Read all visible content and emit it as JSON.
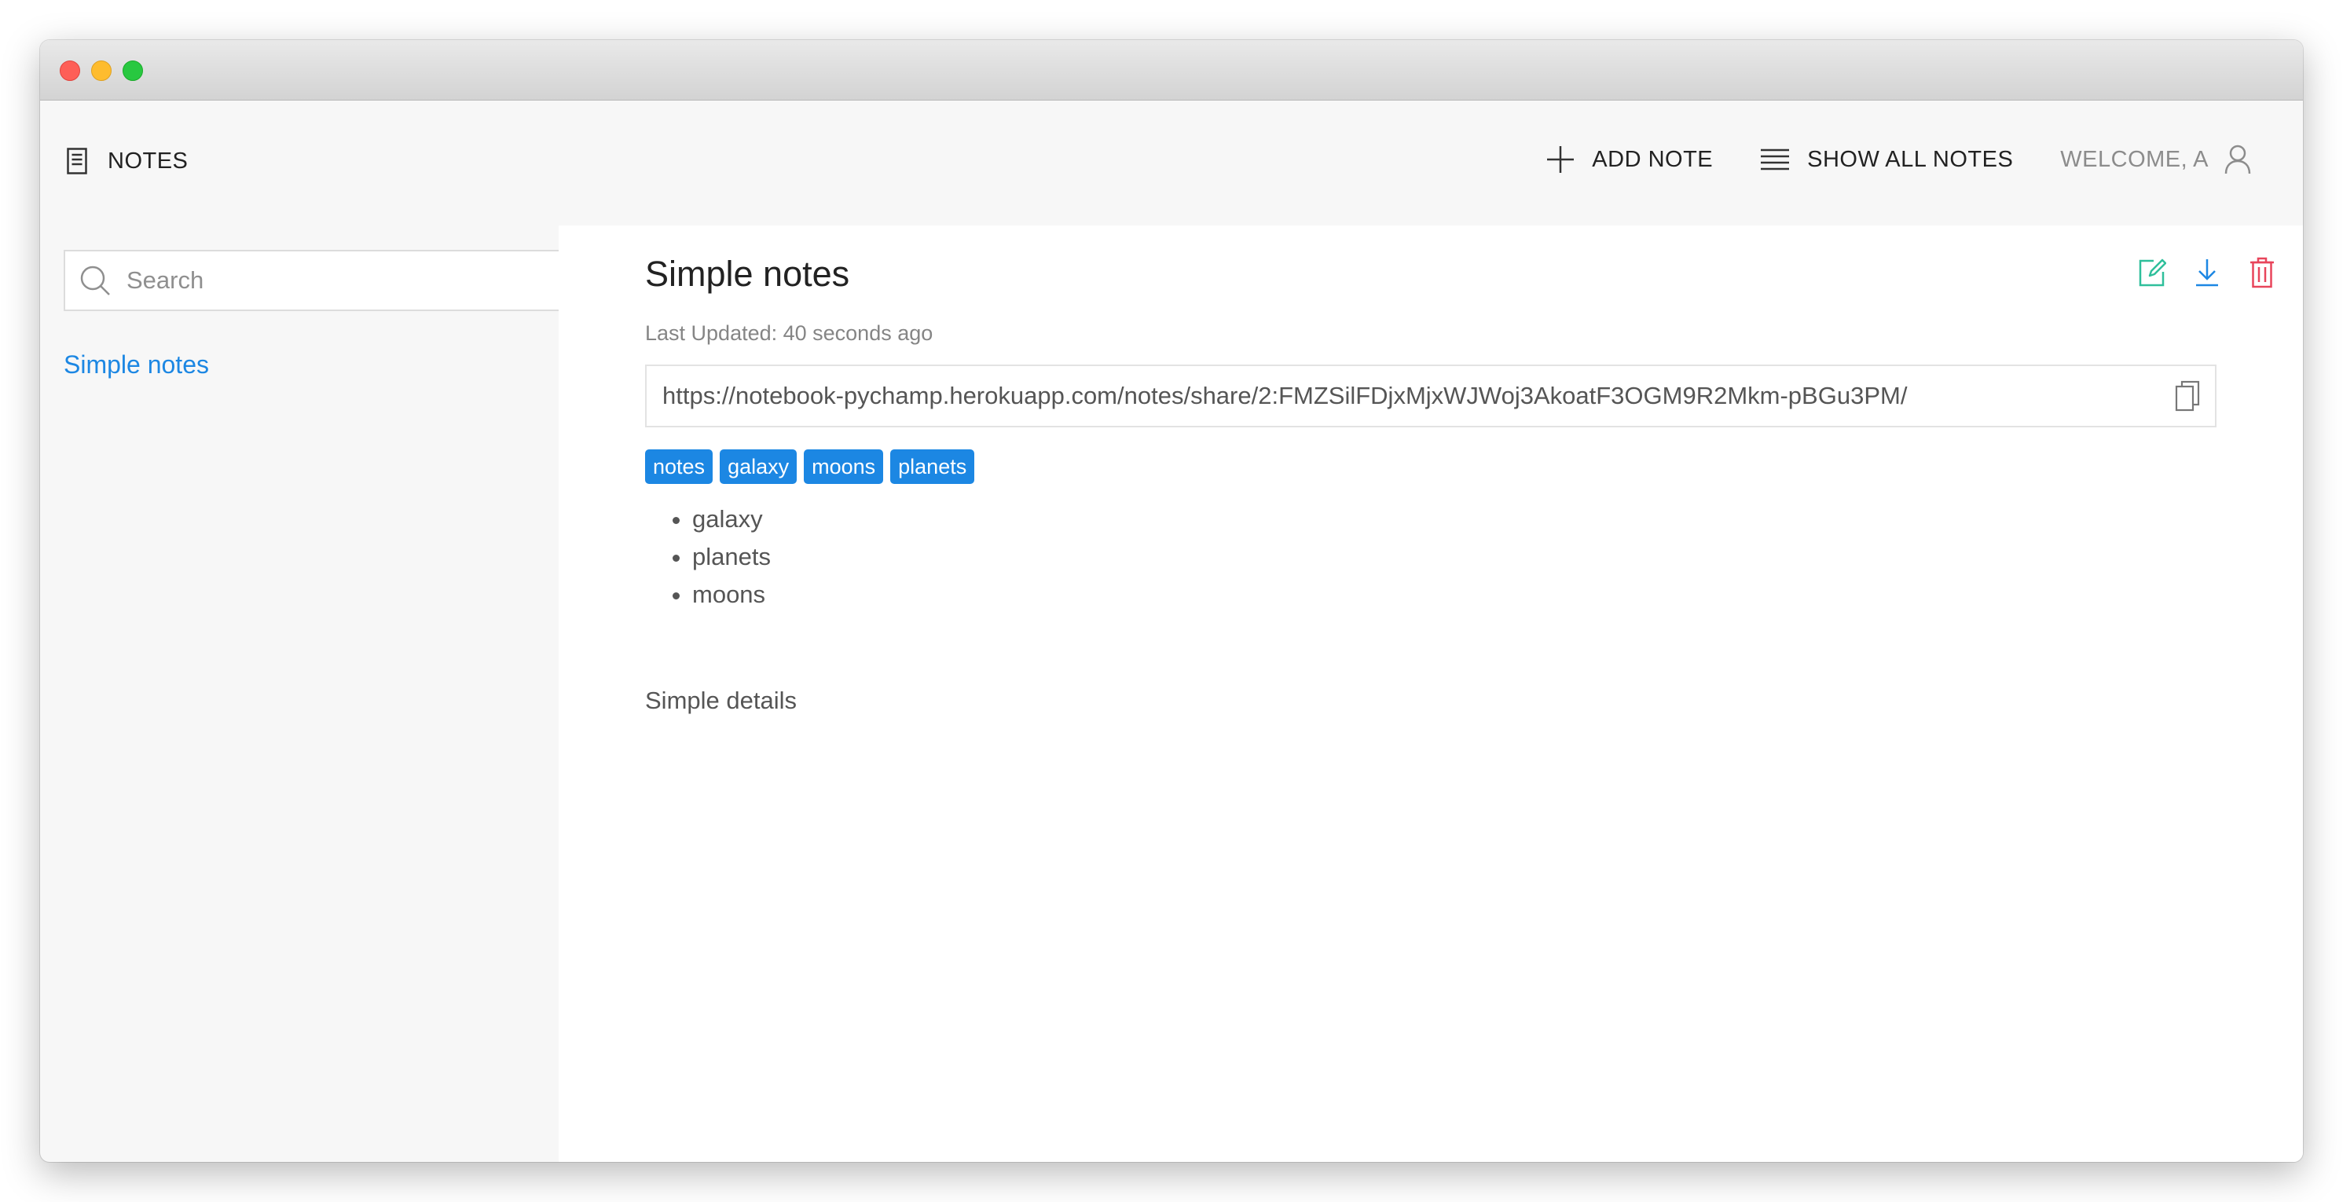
{
  "header": {
    "brand_label": "NOTES",
    "add_note_label": "ADD NOTE",
    "show_all_label": "SHOW ALL NOTES",
    "welcome_label": "WELCOME, A"
  },
  "sidebar": {
    "search_placeholder": "Search",
    "notes": [
      {
        "label": "Simple notes"
      }
    ]
  },
  "note": {
    "title": "Simple notes",
    "last_updated": "Last Updated: 40 seconds ago",
    "share_url": "https://notebook-pychamp.herokuapp.com/notes/share/2:FMZSilFDjxMjxWJWoj3AkoatF3OGM9R2Mkm-pBGu3PM/",
    "tags": [
      "notes",
      "galaxy",
      "moons",
      "planets"
    ],
    "items": [
      "galaxy",
      "planets",
      "moons"
    ],
    "details": "Simple details"
  },
  "icons": {
    "brand": "document-icon",
    "add": "plus-icon",
    "show_all": "list-icon",
    "user": "user-icon",
    "search": "search-icon",
    "copy": "copy-icon",
    "edit": "edit-icon",
    "download": "download-icon",
    "delete": "trash-icon"
  },
  "colors": {
    "link_blue": "#1c87e3",
    "tag_blue": "#1c87e3",
    "edit_green": "#2fbf9b",
    "download_blue": "#1c87e3",
    "delete_red": "#e8455b"
  }
}
